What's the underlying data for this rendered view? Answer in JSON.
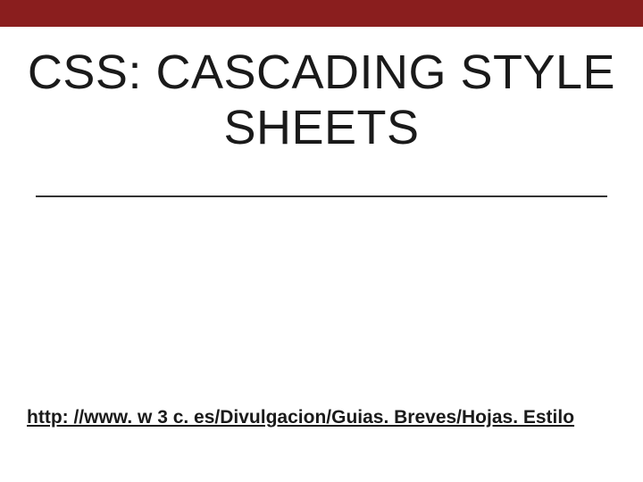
{
  "slide": {
    "title": "CSS: CASCADING STYLE SHEETS",
    "link_text": "http: //www. w 3 c. es/Divulgacion/Guias. Breves/Hojas. Estilo"
  },
  "colors": {
    "accent_bar": "#8a1e1e",
    "text": "#1a1a1a",
    "divider": "#333333"
  }
}
